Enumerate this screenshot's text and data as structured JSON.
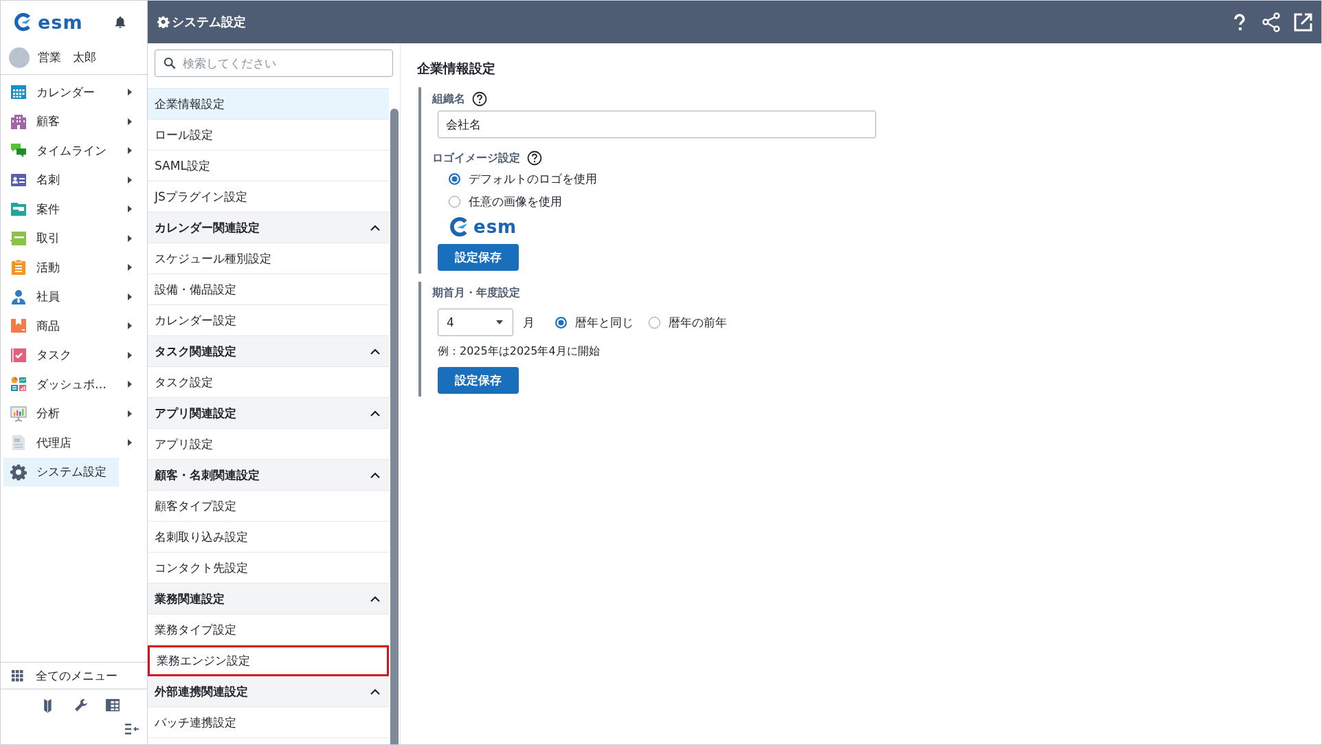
{
  "sidebar": {
    "logo": "esm",
    "user": "営業　太郎",
    "nav": [
      {
        "label": "カレンダー",
        "arrow": true,
        "selected": false
      },
      {
        "label": "顧客",
        "arrow": true,
        "selected": false
      },
      {
        "label": "タイムライン",
        "arrow": true,
        "selected": false
      },
      {
        "label": "名刺",
        "arrow": true,
        "selected": false
      },
      {
        "label": "案件",
        "arrow": true,
        "selected": false
      },
      {
        "label": "取引",
        "arrow": true,
        "selected": false
      },
      {
        "label": "活動",
        "arrow": true,
        "selected": false
      },
      {
        "label": "社員",
        "arrow": true,
        "selected": false
      },
      {
        "label": "商品",
        "arrow": true,
        "selected": false
      },
      {
        "label": "タスク",
        "arrow": true,
        "selected": false
      },
      {
        "label": "ダッシュボ…",
        "arrow": true,
        "selected": false
      },
      {
        "label": "分析",
        "arrow": true,
        "selected": false
      },
      {
        "label": "代理店",
        "arrow": true,
        "selected": false
      },
      {
        "label": "システム設定",
        "arrow": false,
        "selected": true
      }
    ],
    "all_menu": "全てのメニュー"
  },
  "header": {
    "title": "システム設定"
  },
  "settings_list": {
    "search": {
      "placeholder": "検索してください"
    },
    "groups": [
      {
        "items": [
          {
            "label": "企業情報設定",
            "selected": true,
            "highlighted": false
          },
          {
            "label": "ロール設定",
            "selected": false,
            "highlighted": false
          },
          {
            "label": "SAML設定",
            "selected": false,
            "highlighted": false
          },
          {
            "label": "JSプラグイン設定",
            "selected": false,
            "highlighted": false
          }
        ]
      },
      {
        "title": "カレンダー関連設定",
        "expanded": true,
        "items": [
          {
            "label": "スケジュール種別設定",
            "selected": false,
            "highlighted": false
          },
          {
            "label": "設備・備品設定",
            "selected": false,
            "highlighted": false
          },
          {
            "label": "カレンダー設定",
            "selected": false,
            "highlighted": false
          }
        ]
      },
      {
        "title": "タスク関連設定",
        "expanded": true,
        "items": [
          {
            "label": "タスク設定",
            "selected": false,
            "highlighted": false
          }
        ]
      },
      {
        "title": "アプリ関連設定",
        "expanded": true,
        "items": [
          {
            "label": "アプリ設定",
            "selected": false,
            "highlighted": false
          }
        ]
      },
      {
        "title": "顧客・名刺関連設定",
        "expanded": true,
        "items": [
          {
            "label": "顧客タイプ設定",
            "selected": false,
            "highlighted": false
          },
          {
            "label": "名刺取り込み設定",
            "selected": false,
            "highlighted": false
          },
          {
            "label": "コンタクト先設定",
            "selected": false,
            "highlighted": false
          }
        ]
      },
      {
        "title": "業務関連設定",
        "expanded": true,
        "items": [
          {
            "label": "業務タイプ設定",
            "selected": false,
            "highlighted": false
          },
          {
            "label": "業務エンジン設定",
            "selected": false,
            "highlighted": true
          }
        ]
      },
      {
        "title": "外部連携関連設定",
        "expanded": true,
        "items": [
          {
            "label": "バッチ連携設定",
            "selected": false,
            "highlighted": false
          }
        ]
      }
    ]
  },
  "content": {
    "title": "企業情報設定",
    "sections": [
      {
        "blocks": [
          {
            "kind": "label",
            "text": "組織名",
            "help": true
          },
          {
            "kind": "input",
            "value": "会社名"
          },
          {
            "kind": "label",
            "text": "ロゴイメージ設定",
            "help": true
          },
          {
            "kind": "radio",
            "options": [
              {
                "label": "デフォルトのロゴを使用",
                "selected": true
              },
              {
                "label": "任意の画像を使用",
                "selected": false
              }
            ]
          },
          {
            "kind": "logo",
            "text": "esm"
          },
          {
            "kind": "button",
            "text": "設定保存"
          }
        ]
      },
      {
        "blocks": [
          {
            "kind": "label",
            "text": "期首月・年度設定",
            "help": false
          },
          {
            "kind": "month",
            "value": "4",
            "unit": "月",
            "options": [
              {
                "label": "暦年と同じ",
                "selected": true
              },
              {
                "label": "暦年の前年",
                "selected": false
              }
            ]
          },
          {
            "kind": "note",
            "text": "例：2025年は2025年4月に開始"
          },
          {
            "kind": "button",
            "text": "設定保存"
          }
        ]
      }
    ]
  }
}
